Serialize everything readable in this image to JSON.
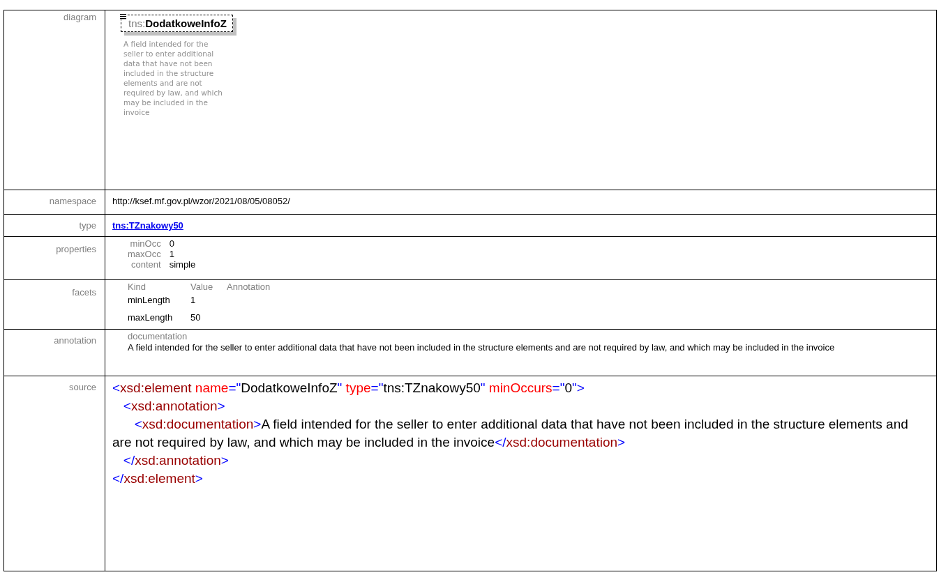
{
  "rows": [
    {
      "label": "diagram",
      "kind": "diagram",
      "prefix": "tns:",
      "name": "DodatkoweInfoZ",
      "description": "A field intended for the seller to enter additional data that have not been included in the structure elements and are not required by law, and which may be included in the invoice"
    },
    {
      "label": "namespace",
      "kind": "text",
      "text": "http://ksef.mf.gov.pl/wzor/2021/08/05/08052/"
    },
    {
      "label": "type",
      "kind": "link",
      "text": "tns:TZnakowy50"
    },
    {
      "label": "properties",
      "kind": "properties",
      "items": [
        {
          "key": "minOcc",
          "value": "0"
        },
        {
          "key": "maxOcc",
          "value": "1"
        },
        {
          "key": "content",
          "value": "simple"
        }
      ]
    },
    {
      "label": "facets",
      "kind": "facets",
      "columns": [
        "Kind",
        "Value",
        "Annotation"
      ],
      "items": [
        {
          "kind": "minLength",
          "value": "1"
        },
        {
          "kind": "maxLength",
          "value": "50"
        }
      ]
    },
    {
      "label": "annotation",
      "kind": "annotation",
      "heading": "documentation",
      "text": "A field intended for the seller to enter additional data that have not been included in the structure elements and are not required by law, and which may be included in the invoice"
    },
    {
      "label": "source",
      "kind": "source",
      "lines": [
        [
          {
            "kind": "bracket",
            "text": "<"
          },
          {
            "kind": "tag",
            "text": "xsd:element"
          },
          {
            "kind": "attr",
            "text": " name"
          },
          {
            "kind": "bracket",
            "text": "=\""
          },
          {
            "kind": "value",
            "text": "DodatkoweInfoZ"
          },
          {
            "kind": "bracket",
            "text": "\""
          },
          {
            "kind": "attr",
            "text": " type"
          },
          {
            "kind": "bracket",
            "text": "=\""
          },
          {
            "kind": "value",
            "text": "tns:TZnakowy50"
          },
          {
            "kind": "bracket",
            "text": "\""
          },
          {
            "kind": "attr",
            "text": " minOccurs"
          },
          {
            "kind": "bracket",
            "text": "=\""
          },
          {
            "kind": "value",
            "text": "0"
          },
          {
            "kind": "bracket",
            "text": "\">"
          }
        ],
        [
          {
            "kind": "bracket",
            "text": "   <"
          },
          {
            "kind": "tag",
            "text": "xsd:annotation"
          },
          {
            "kind": "bracket",
            "text": ">"
          }
        ],
        [
          {
            "kind": "bracket",
            "text": "      <"
          },
          {
            "kind": "tag",
            "text": "xsd:documentation"
          },
          {
            "kind": "bracket",
            "text": ">"
          },
          {
            "kind": "value",
            "text": "A field intended for the seller to enter additional data that have not been included in the structure elements and are not required by law, and which may be included in the invoice"
          },
          {
            "kind": "bracket",
            "text": "</"
          },
          {
            "kind": "tag",
            "text": "xsd:documentation"
          },
          {
            "kind": "bracket",
            "text": ">"
          }
        ],
        [
          {
            "kind": "bracket",
            "text": "   </"
          },
          {
            "kind": "tag",
            "text": "xsd:annotation"
          },
          {
            "kind": "bracket",
            "text": ">"
          }
        ],
        [
          {
            "kind": "bracket",
            "text": "</"
          },
          {
            "kind": "tag",
            "text": "xsd:element"
          },
          {
            "kind": "bracket",
            "text": ">"
          }
        ]
      ]
    }
  ]
}
